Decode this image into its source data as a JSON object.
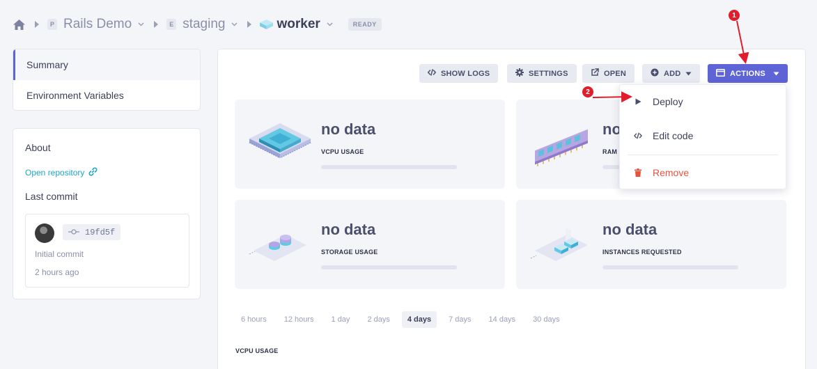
{
  "breadcrumb": {
    "project": {
      "badge": "P",
      "label": "Rails Demo"
    },
    "environment": {
      "badge": "E",
      "label": "staging"
    },
    "service": {
      "label": "worker"
    },
    "status": "READY"
  },
  "sidebar": {
    "items": [
      {
        "label": "Summary",
        "active": true
      },
      {
        "label": "Environment Variables",
        "active": false
      }
    ]
  },
  "about": {
    "title": "About",
    "repo_link": "Open repository",
    "commit_title": "Last commit",
    "commit": {
      "hash": "19fd5f",
      "message": "Initial commit",
      "time": "2 hours ago"
    }
  },
  "toolbar": {
    "show_logs": "SHOW LOGS",
    "settings": "SETTINGS",
    "open": "OPEN",
    "add": "ADD",
    "actions": "ACTIONS"
  },
  "stats": [
    {
      "value": "no data",
      "label": "VCPU USAGE",
      "icon": "cpu-icon"
    },
    {
      "value": "no data",
      "label": "RAM USAGE",
      "icon": "ram-icon"
    },
    {
      "value": "no data",
      "label": "STORAGE USAGE",
      "icon": "storage-icon"
    },
    {
      "value": "no data",
      "label": "INSTANCES REQUESTED",
      "icon": "instances-icon"
    }
  ],
  "ranges": {
    "options": [
      "6 hours",
      "12 hours",
      "1 day",
      "2 days",
      "4 days",
      "7 days",
      "14 days",
      "30 days"
    ],
    "selected": "4 days"
  },
  "chart_section_label": "VCPU USAGE",
  "actions_menu": {
    "items": [
      {
        "label": "Deploy",
        "icon": "play-icon"
      },
      {
        "label": "Edit code",
        "icon": "code-icon"
      },
      {
        "label": "Remove",
        "icon": "trash-icon"
      }
    ]
  },
  "annotations": {
    "marker_1": "1",
    "marker_2": "2"
  },
  "colors": {
    "accent": "#5e64d6",
    "link": "#1fa6c8",
    "danger": "#e5533d",
    "annotation": "#e11d2b",
    "background": "#f4f5f9"
  }
}
